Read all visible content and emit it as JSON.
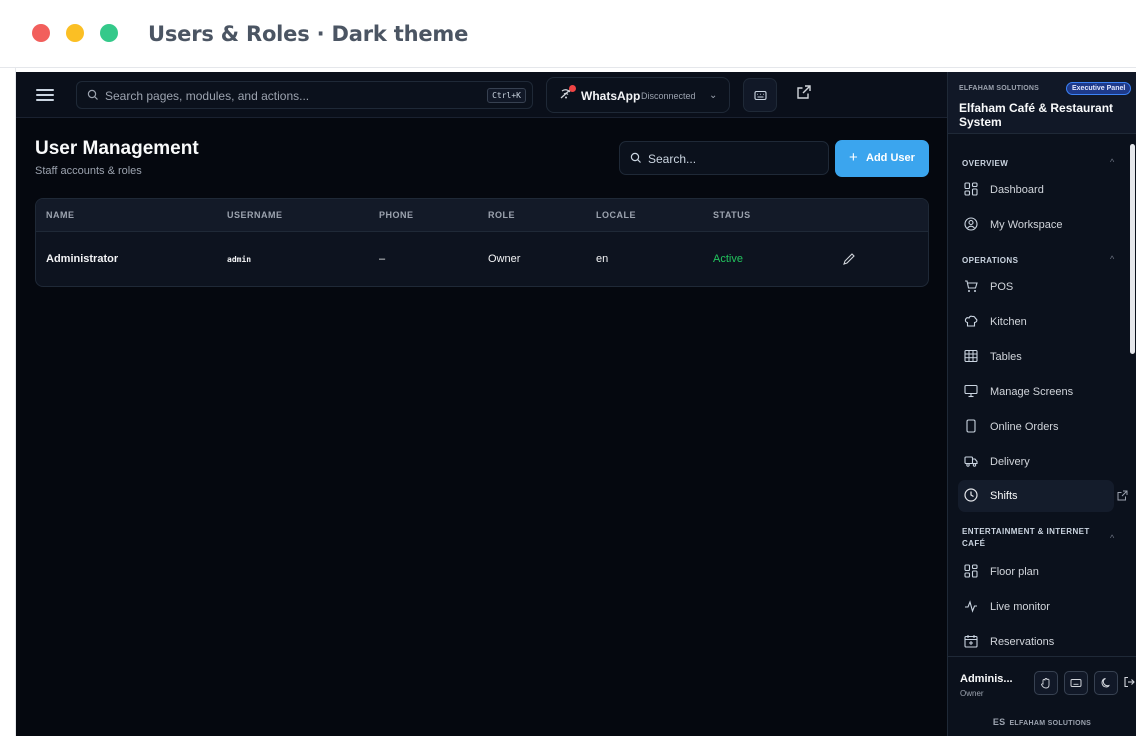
{
  "window": {
    "title": "Users & Roles · Dark theme"
  },
  "topbar": {
    "search_placeholder": "Search pages, modules, and actions...",
    "search_shortcut": "Ctrl+K",
    "whatsapp_label": "WhatsApp",
    "whatsapp_status": "Disconnected"
  },
  "main": {
    "title": "User Management",
    "subtitle": "Staff accounts & roles",
    "search_placeholder": "Search...",
    "add_button": "Add User",
    "add_icon": "+"
  },
  "table": {
    "columns": [
      "NAME",
      "USERNAME",
      "PHONE",
      "ROLE",
      "LOCALE",
      "STATUS"
    ],
    "rows": [
      {
        "name": "Administrator",
        "username": "admin",
        "phone": "–",
        "role": "Owner",
        "locale": "en",
        "status": "Active"
      }
    ]
  },
  "sidebar": {
    "org": "ELFAHAM SOLUTIONS",
    "badge": "Executive Panel",
    "app_name": "Elfaham Café & Restaurant System",
    "sections": [
      {
        "title": "OVERVIEW",
        "items": [
          {
            "label": "Dashboard",
            "icon": "grid-icon"
          },
          {
            "label": "My Workspace",
            "icon": "user-circle-icon"
          }
        ]
      },
      {
        "title": "OPERATIONS",
        "items": [
          {
            "label": "POS",
            "icon": "cart-icon"
          },
          {
            "label": "Kitchen",
            "icon": "chef-hat-icon"
          },
          {
            "label": "Tables",
            "icon": "table-icon"
          },
          {
            "label": "Manage Screens",
            "icon": "monitor-icon"
          },
          {
            "label": "Online Orders",
            "icon": "phone-icon"
          },
          {
            "label": "Delivery",
            "icon": "truck-icon"
          },
          {
            "label": "Shifts",
            "icon": "clock-icon"
          }
        ]
      },
      {
        "title": "ENTERTAINMENT & INTERNET CAFÉ",
        "items": [
          {
            "label": "Floor plan",
            "icon": "grid-icon"
          },
          {
            "label": "Live monitor",
            "icon": "activity-icon"
          },
          {
            "label": "Reservations",
            "icon": "calendar-icon"
          }
        ]
      }
    ],
    "active_item": "Shifts",
    "footer": {
      "user": "Adminis...",
      "role": "Owner",
      "brand": "ELFAHAM SOLUTIONS"
    }
  },
  "colors": {
    "accent": "#3ba5ee",
    "active_status": "#22c55e",
    "bg": "#05080f",
    "sidebar_bg": "#0b111c"
  }
}
